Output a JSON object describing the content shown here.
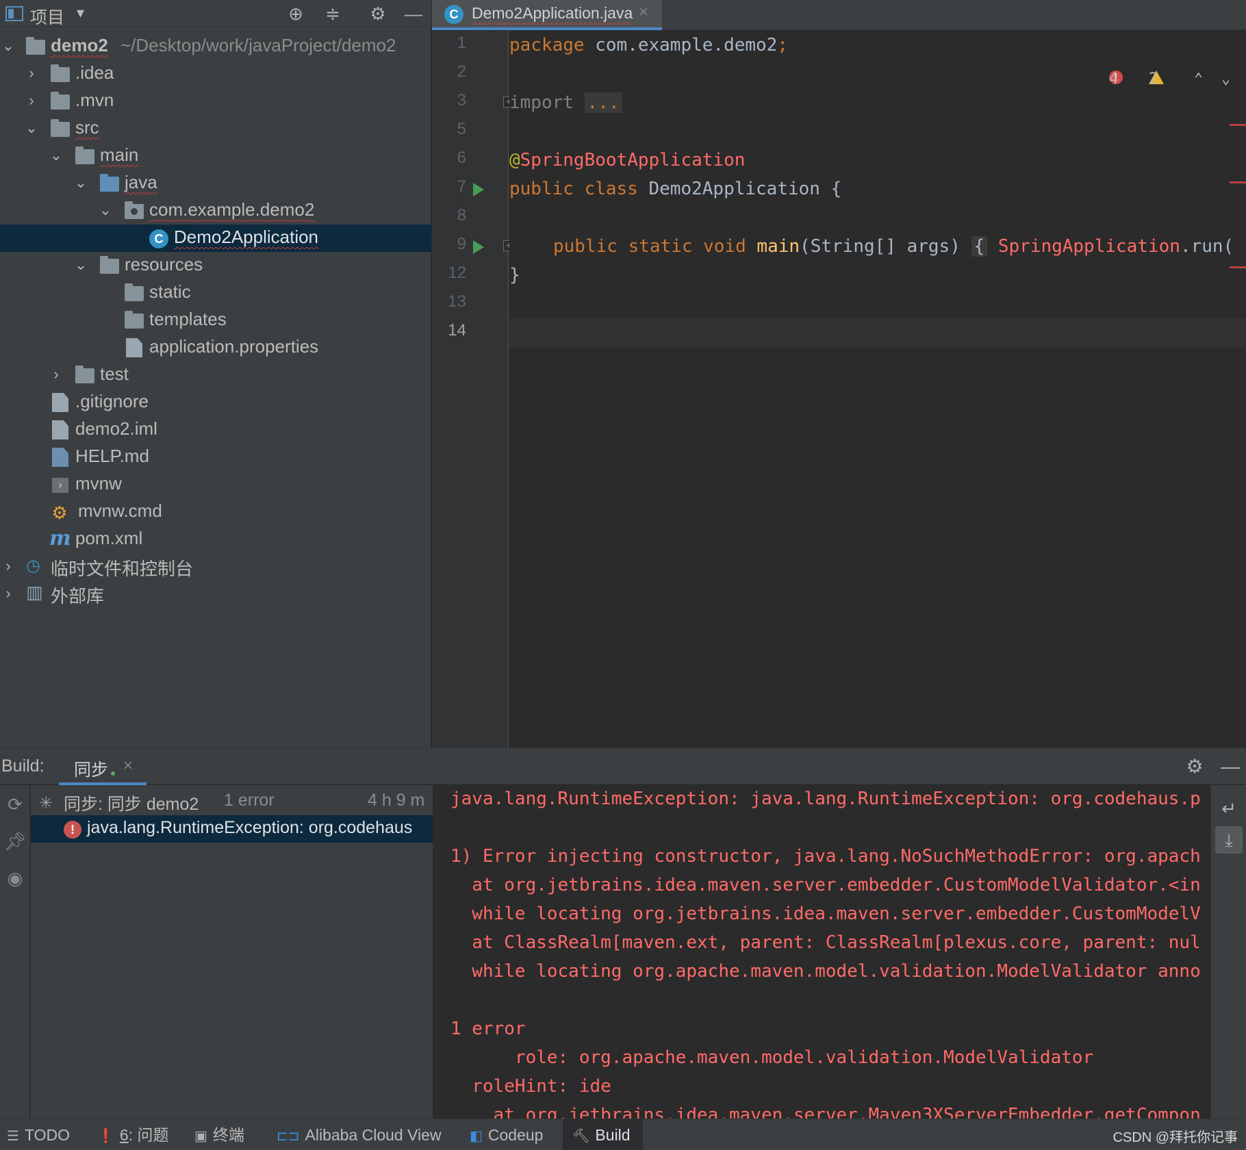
{
  "project_panel": {
    "title": "项目",
    "tree": [
      {
        "label": "demo2",
        "path": "~/Desktop/work/javaProject/demo2"
      },
      {
        "label": ".idea"
      },
      {
        "label": ".mvn"
      },
      {
        "label": "src"
      },
      {
        "label": "main"
      },
      {
        "label": "java"
      },
      {
        "label": "com.example.demo2"
      },
      {
        "label": "Demo2Application"
      },
      {
        "label": "resources"
      },
      {
        "label": "static"
      },
      {
        "label": "templates"
      },
      {
        "label": "application.properties"
      },
      {
        "label": "test"
      },
      {
        "label": ".gitignore"
      },
      {
        "label": "demo2.iml"
      },
      {
        "label": "HELP.md"
      },
      {
        "label": "mvnw"
      },
      {
        "label": "mvnw.cmd"
      },
      {
        "label": "pom.xml"
      },
      {
        "label": "临时文件和控制台"
      },
      {
        "label": "外部库"
      }
    ]
  },
  "editor": {
    "tab_label": "Demo2Application.java",
    "inspections": {
      "errors": "4",
      "warnings": "2"
    },
    "line_numbers": [
      "1",
      "2",
      "3",
      "5",
      "6",
      "7",
      "8",
      "9",
      "12",
      "13",
      "14"
    ],
    "code": {
      "l1_kw": "package",
      "l1_rest": " com.example.demo2",
      "l1_semi": ";",
      "l3_kw": "import",
      "l3_fold": "...",
      "l6_at": "@",
      "l6_ann": "SpringBootApplication",
      "l7_kw": "public class",
      "l7_rest": " Demo2Application {",
      "l9_kw": "public static void",
      "l9_fn": "main",
      "l9_rest": "(String[] args)",
      "l9_brace": "{",
      "l9_err": "SpringApplication",
      "l9_tail": ".run(",
      "l13": "}"
    }
  },
  "build": {
    "title": "Build:",
    "tab_label": "同步",
    "tree_root": {
      "label": "同步: 同步 demo2",
      "count": "1 error",
      "time": "4 h 9 m"
    },
    "tree_error": "java.lang.RuntimeException: org.codehaus",
    "console": [
      "java.lang.RuntimeException: java.lang.RuntimeException: org.codehaus.p",
      "",
      "1) Error injecting constructor, java.lang.NoSuchMethodError: org.apach",
      "  at org.jetbrains.idea.maven.server.embedder.CustomModelValidator.<in",
      "  while locating org.jetbrains.idea.maven.server.embedder.CustomModelV",
      "  at ClassRealm[maven.ext, parent: ClassRealm[plexus.core, parent: nul",
      "  while locating org.apache.maven.model.validation.ModelValidator anno",
      "",
      "1 error",
      "      role: org.apache.maven.model.validation.ModelValidator",
      "  roleHint: ide",
      "    at org.jetbrains.idea.maven.server.Maven3XServerEmbedder.getCompon"
    ]
  },
  "statusbar": {
    "todo": "TODO",
    "problems_num": "6",
    "problems": ": 问题",
    "terminal": "终端",
    "alibaba": "Alibaba Cloud View",
    "codeup": "Codeup",
    "build": "Build",
    "watermark": "CSDN @拜托你记事"
  },
  "colors": {
    "accent": "#4a88c7",
    "error": "#ff6b68",
    "keyword": "#cc7832",
    "run_green": "#499c54"
  }
}
